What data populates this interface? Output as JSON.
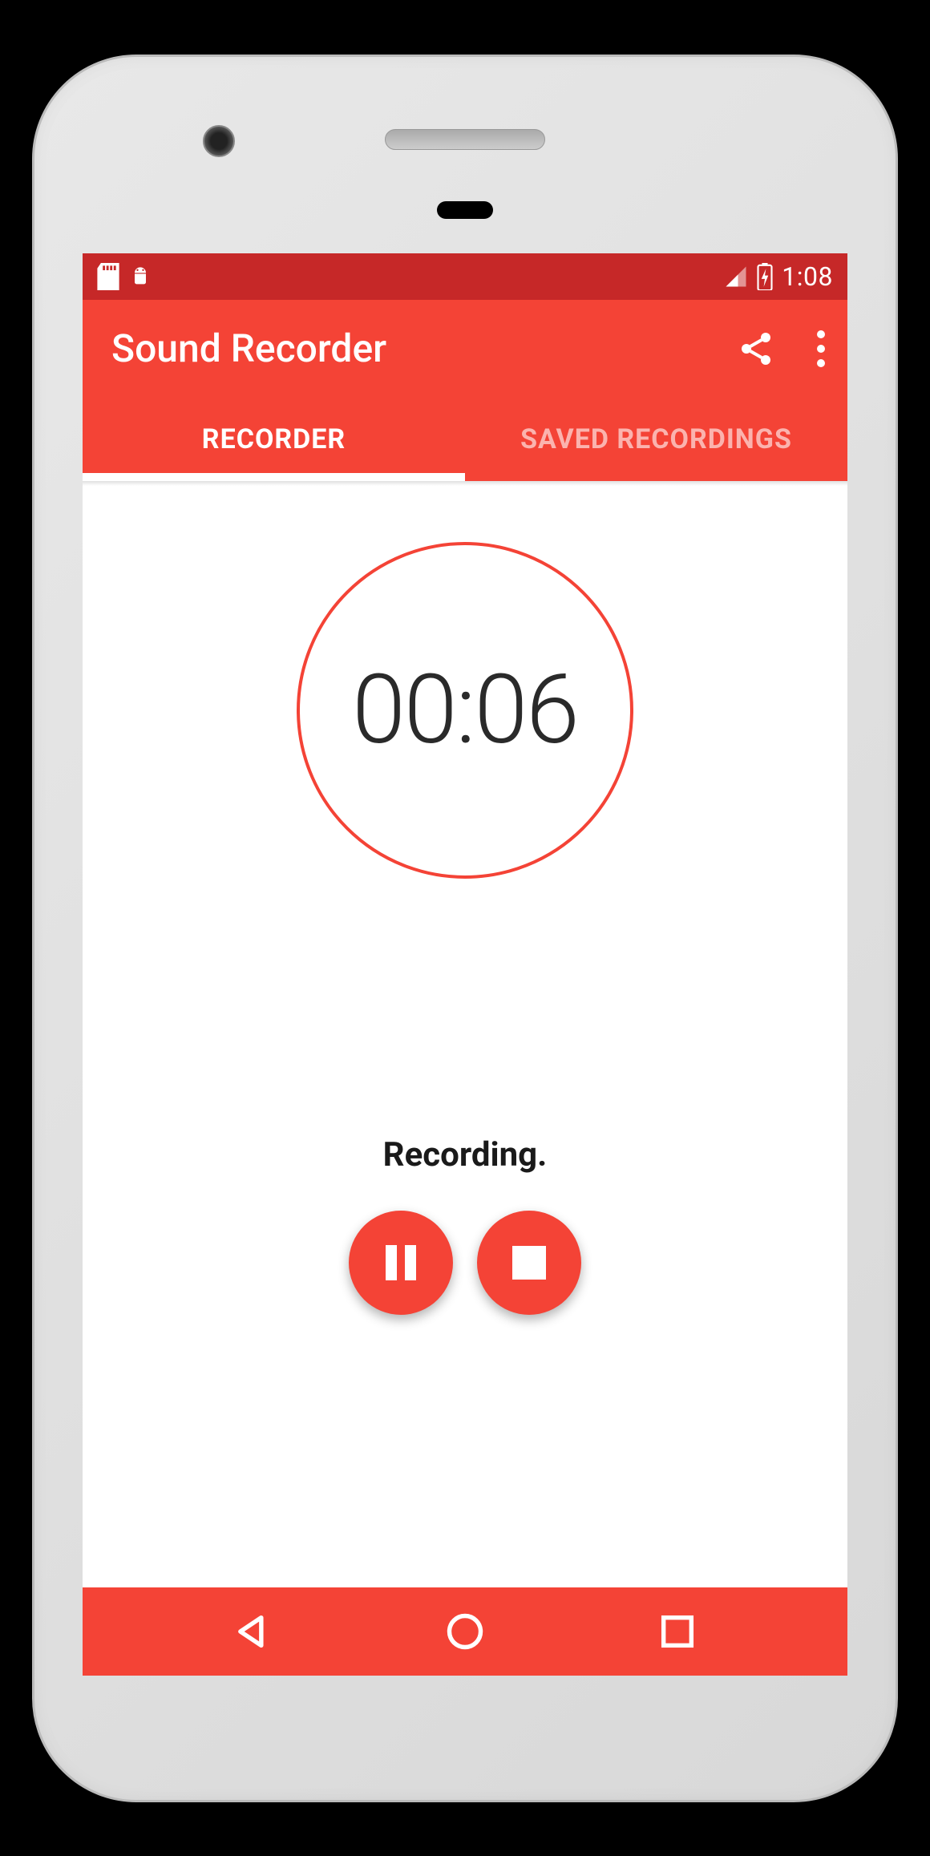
{
  "status": {
    "clock": "1:08"
  },
  "app": {
    "title": "Sound Recorder"
  },
  "tabs": {
    "recorder": "RECORDER",
    "saved": "SAVED RECORDINGS"
  },
  "recorder": {
    "timer": "00:06",
    "status_label": "Recording."
  },
  "colors": {
    "primary": "#f44336",
    "primary_dark": "#c62828"
  }
}
